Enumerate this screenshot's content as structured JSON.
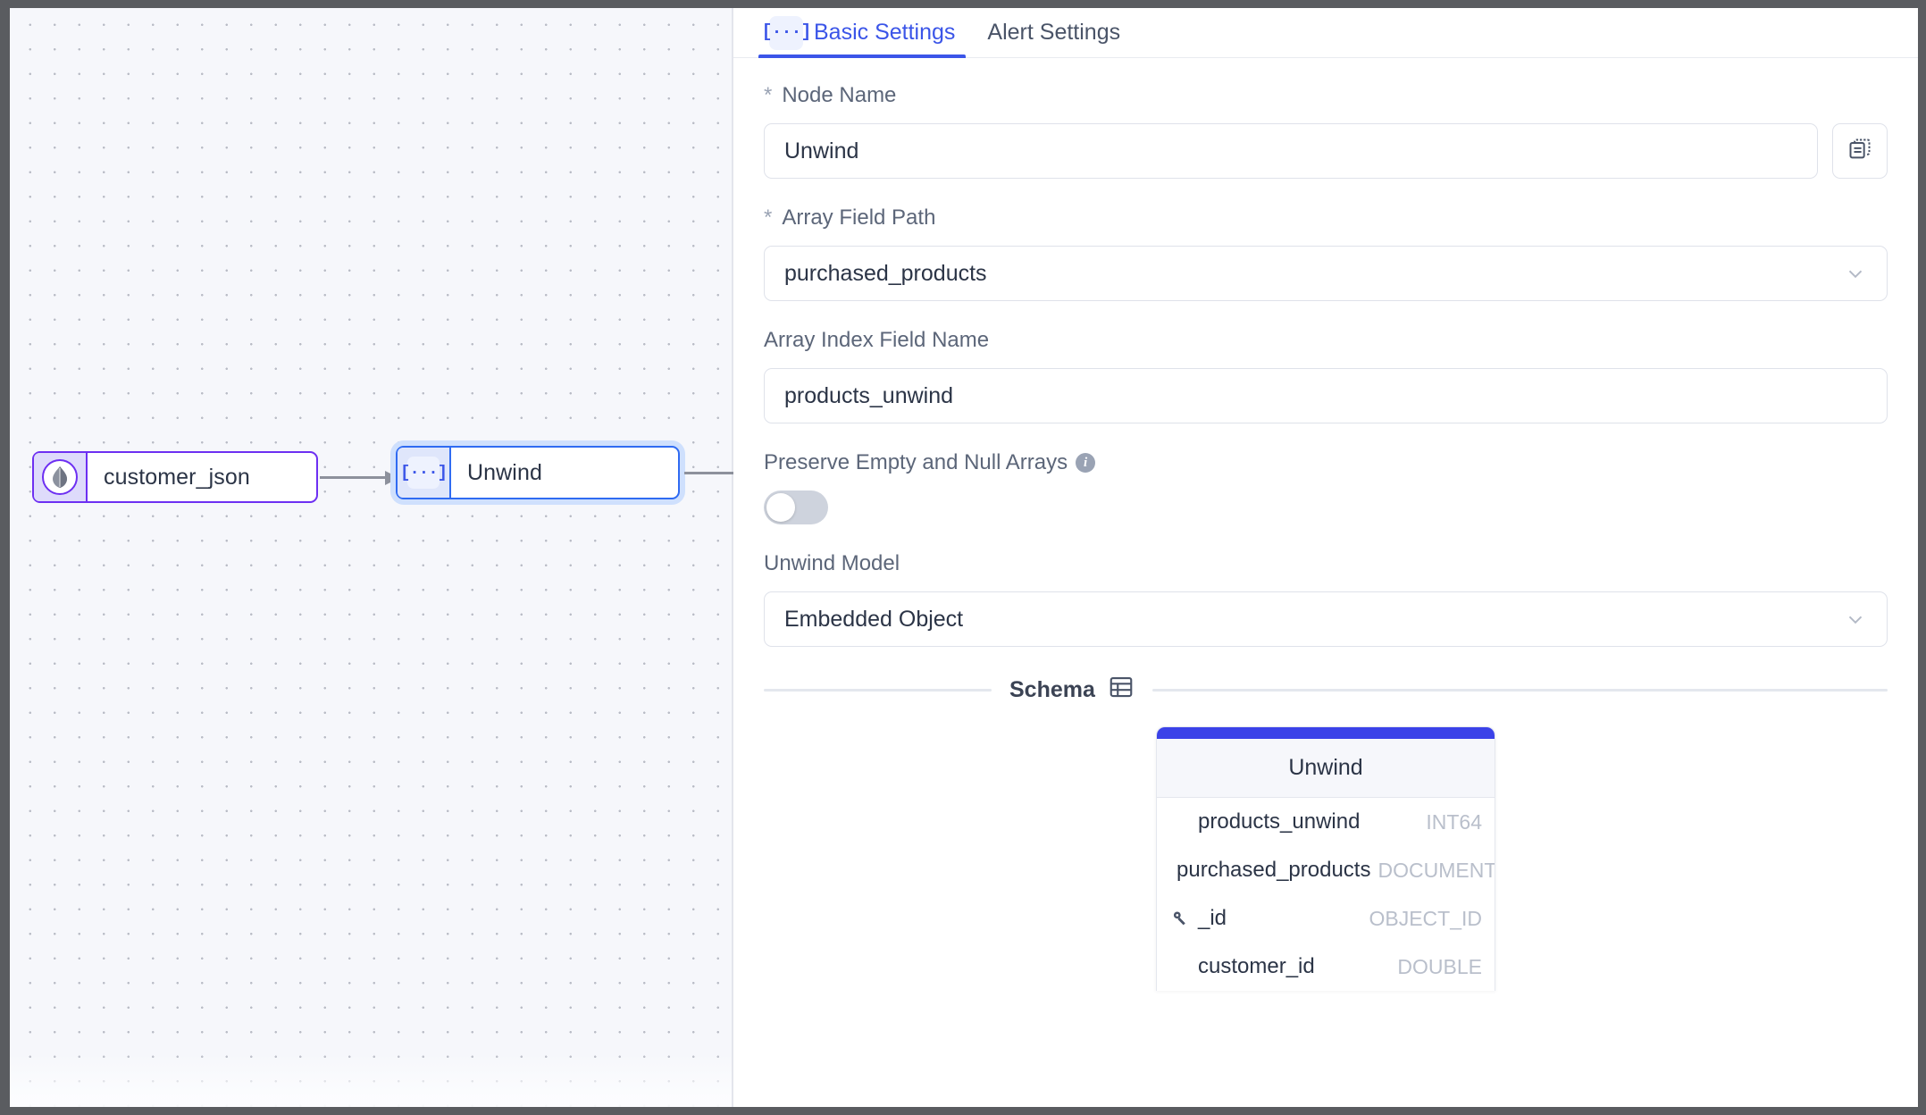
{
  "canvas": {
    "nodes": [
      {
        "id": "source",
        "label": "customer_json",
        "icon": "mongodb-leaf-icon"
      },
      {
        "id": "unwind",
        "label": "Unwind",
        "icon": "bracket-ellipsis-icon",
        "selected": true
      }
    ]
  },
  "tabs": [
    {
      "id": "basic",
      "label": "Basic Settings",
      "icon": "[···]",
      "active": true
    },
    {
      "id": "alert",
      "label": "Alert Settings",
      "active": false
    }
  ],
  "form": {
    "node_name": {
      "label": "Node Name",
      "required_mark": "*",
      "value": "Unwind",
      "copy_button": "copy-icon"
    },
    "array_field_path": {
      "label": "Array Field Path",
      "required_mark": "*",
      "value": "purchased_products"
    },
    "array_index_field_name": {
      "label": "Array Index Field Name",
      "value": "products_unwind"
    },
    "preserve_empty": {
      "label": "Preserve Empty and Null Arrays",
      "info": "i",
      "enabled": false
    },
    "unwind_model": {
      "label": "Unwind Model",
      "value": "Embedded Object"
    }
  },
  "schema": {
    "title": "Schema",
    "icon": "table-icon",
    "card_title": "Unwind",
    "rows": [
      {
        "name": "products_unwind",
        "type": "INT64",
        "key": false
      },
      {
        "name": "purchased_products",
        "type": "DOCUMENT",
        "key": false
      },
      {
        "name": "_id",
        "type": "OBJECT_ID",
        "key": true
      },
      {
        "name": "customer_id",
        "type": "DOUBLE",
        "key": false
      }
    ]
  },
  "colors": {
    "accent_blue": "#3b55e8",
    "node_purple": "#6d2ff2",
    "node_selected_blue": "#2f6bf2",
    "schema_bar": "#3b42e8",
    "text_dark": "#2b3446",
    "text_muted": "#5c6679",
    "type_muted": "#b9bfcb"
  }
}
